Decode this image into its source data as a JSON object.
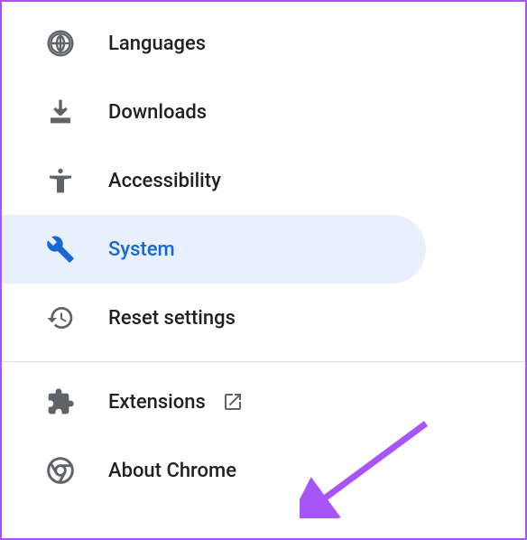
{
  "nav": {
    "items": [
      {
        "label": "Languages",
        "icon": "globe-icon",
        "selected": false
      },
      {
        "label": "Downloads",
        "icon": "download-icon",
        "selected": false
      },
      {
        "label": "Accessibility",
        "icon": "accessibility-icon",
        "selected": false
      },
      {
        "label": "System",
        "icon": "wrench-icon",
        "selected": true
      },
      {
        "label": "Reset settings",
        "icon": "history-icon",
        "selected": false
      }
    ],
    "footer": [
      {
        "label": "Extensions",
        "icon": "puzzle-icon",
        "external": true
      },
      {
        "label": "About Chrome",
        "icon": "chrome-icon",
        "external": false
      }
    ]
  },
  "colors": {
    "accent": "#1967d2",
    "selected_bg": "#e8f0fe",
    "icon": "#5f6368",
    "text": "#202124",
    "annotation_arrow": "#a855f7"
  }
}
